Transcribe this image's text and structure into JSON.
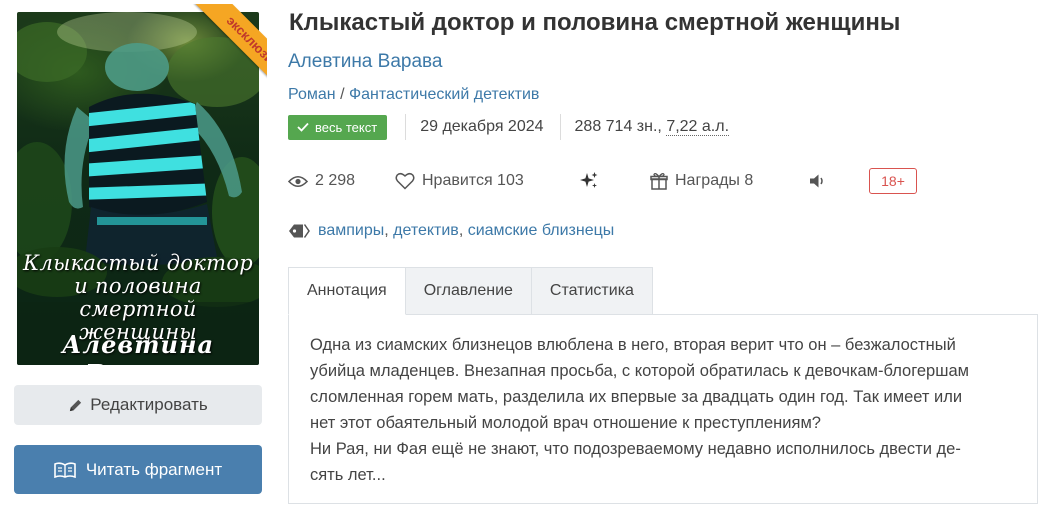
{
  "cover": {
    "ribbon": "эксклюзив",
    "title_lines": [
      "Клыкастый доктор",
      "и половина",
      "смертной женщины"
    ],
    "author": "Алевтина Варава"
  },
  "buttons": {
    "edit": "Редактировать",
    "read_fragment": "Читать фрагмент"
  },
  "book": {
    "title": "Клыкастый доктор и половина смертной женщины",
    "author": "Алевтина Варава",
    "genre_main": "Роман",
    "genre_sep": "/",
    "genre_sub": "Фантастический детектив",
    "status_badge": "весь текст",
    "date": "29 декабря 2024",
    "size": "288 714 зн., ",
    "size_al": "7,22 а.л."
  },
  "stats": {
    "views": "2 298",
    "likes": "Нравится 103",
    "awards": "Награды 8",
    "age_rating": "18+"
  },
  "tags": [
    {
      "label": "вампиры"
    },
    {
      "label": "детектив"
    },
    {
      "label": "сиамские близнецы"
    }
  ],
  "tabs": [
    "Аннотация",
    "Оглавление",
    "Статистика"
  ],
  "annotation": {
    "lines": [
      "Одна из сиамских близнецов влюблена в него, вторая верит что он – безжалостный",
      "убийца младенцев. Внезапная просьба, с которой обратилась к девочкам-блогершам",
      "сломленная горем мать, разделила их впервые за двадцать один год. Так имеет или",
      "нет этот обаятельный молодой врач отношение к преступлениям?",
      "Ни Рая, ни Фая ещё не знают, что подозреваемому недавно исполнилось двести де-",
      "сять лет..."
    ]
  },
  "colors": {
    "link": "#3d79a8",
    "badge_green": "#55a74f",
    "read_button": "#4a7fae",
    "age_badge": "#d9534f",
    "ribbon": "#f5a623"
  },
  "icons": [
    "eye-icon",
    "heart-icon",
    "sparkle-icon",
    "gift-icon",
    "audio-icon",
    "tag-icon",
    "pencil-icon",
    "book-open-icon",
    "check-icon"
  ]
}
